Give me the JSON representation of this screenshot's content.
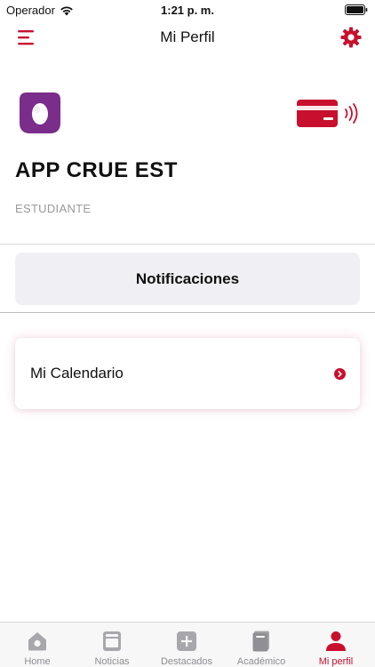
{
  "status_bar": {
    "carrier": "Operador",
    "time": "1:21 p. m."
  },
  "header": {
    "title": "Mi Perfil",
    "menu_icon": "hamburger-menu-icon",
    "settings_icon": "gear-icon"
  },
  "profile": {
    "name": "APP CRUE EST",
    "role": "ESTUDIANTE",
    "logo_icon": "egg-logo-icon",
    "card_icon": "contactless-card-icon"
  },
  "notifications": {
    "label": "Notificaciones"
  },
  "calendar": {
    "label": "Mi Calendario"
  },
  "tabs": [
    {
      "label": "Home",
      "icon": "home-icon"
    },
    {
      "label": "Noticias",
      "icon": "news-icon"
    },
    {
      "label": "Destacados",
      "icon": "plus-icon"
    },
    {
      "label": "Académico",
      "icon": "book-icon"
    },
    {
      "label": "Mi perfil",
      "icon": "person-icon",
      "active": true
    }
  ],
  "colors": {
    "accent": "#c8102e",
    "logo_purple": "#7a2d8a",
    "inactive_tab": "#8e8e93",
    "button_bg": "#f0f0f4"
  }
}
